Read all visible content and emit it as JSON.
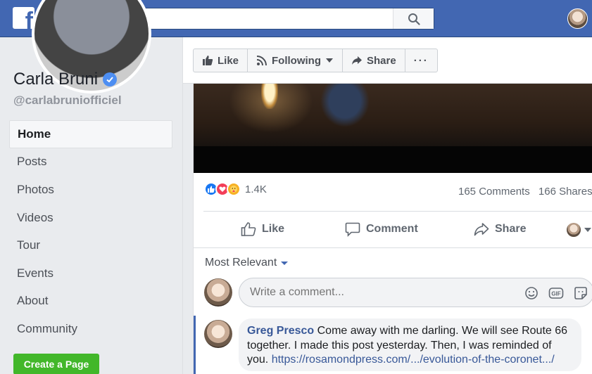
{
  "topbar": {
    "logo_letter": "f",
    "search_value": "Carla Bruni"
  },
  "page": {
    "name": "Carla Bruni",
    "username": "@carlabruniofficiel",
    "nav": [
      {
        "label": "Home",
        "active": true
      },
      {
        "label": "Posts"
      },
      {
        "label": "Photos"
      },
      {
        "label": "Videos"
      },
      {
        "label": "Tour"
      },
      {
        "label": "Events"
      },
      {
        "label": "About"
      },
      {
        "label": "Community"
      }
    ],
    "create_page_label": "Create a Page"
  },
  "actionbar": {
    "like_label": "Like",
    "following_label": "Following",
    "share_label": "Share",
    "more_label": "···"
  },
  "post": {
    "reaction_count": "1.4K",
    "comments_count": "165 Comments",
    "shares_count": "166 Shares",
    "actions": {
      "like": "Like",
      "comment": "Comment",
      "share": "Share"
    },
    "sort_label": "Most Relevant",
    "comment_placeholder": "Write a comment...",
    "comment_icons": [
      "emoji-icon",
      "gif-icon",
      "sticker-icon"
    ],
    "comments": [
      {
        "author": "Greg Presco",
        "text_1": "Come away with me darling. We will see Route 66 together. I made this post yesterday. Then, I was reminded of you.",
        "link": "https://rosamondpress.com/.../evolution-of-the-coronet.../"
      }
    ]
  },
  "colors": {
    "brand": "#4267b2",
    "link": "#385898",
    "green": "#42b72a",
    "verified": "#4d8ef2"
  }
}
